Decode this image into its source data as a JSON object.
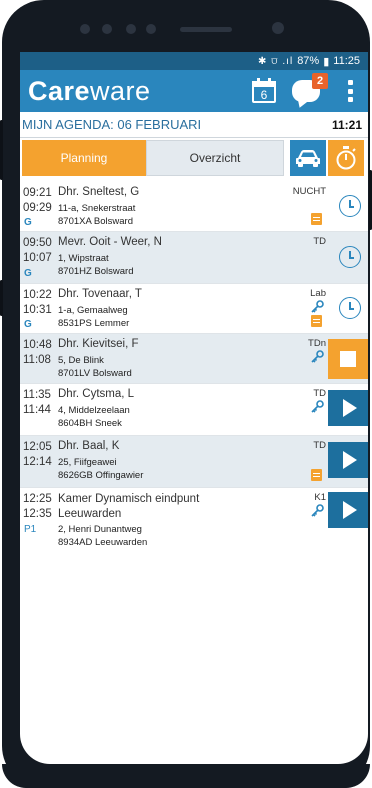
{
  "status_bar": {
    "icons": "✱ ⩌ .ıl",
    "battery_text": "87%",
    "time": "11:25"
  },
  "app_bar": {
    "logo_bold": "Care",
    "logo_light": "ware",
    "calendar_day": "6",
    "messages_badge": "2"
  },
  "agenda": {
    "title": "MIJN AGENDA: 06 FEBRUARI",
    "current_time": "11:21"
  },
  "tabs": {
    "planning": "Planning",
    "overzicht": "Overzicht"
  },
  "colors": {
    "primary": "#2a86bd",
    "dark_primary": "#1d5f87",
    "accent_orange": "#f4a22f",
    "row_alt": "#e4ebf0",
    "badge": "#e8632b"
  },
  "appointments": [
    {
      "start": "09:21",
      "end": "09:29",
      "name": "Dhr. Sneltest, G",
      "street": "11-a, Snekerstraat",
      "postal": "8701XA Bolsward",
      "letter": "G",
      "code": "NUCHT",
      "icons": [
        "note-icon"
      ],
      "action": "clock-icon"
    },
    {
      "start": "09:50",
      "end": "10:07",
      "name": "Mevr. Ooit - Weer, N",
      "street": "1, Wipstraat",
      "postal": "8701HZ Bolsward",
      "letter": "G",
      "code": "TD",
      "icons": [],
      "action": "clock-icon"
    },
    {
      "start": "10:22",
      "end": "10:31",
      "name": "Dhr. Tovenaar, T",
      "street": "1-a, Gemaalweg",
      "postal": "8531PS Lemmer",
      "letter": "G",
      "code": "Lab",
      "icons": [
        "key-icon",
        "note-icon"
      ],
      "action": "clock-icon"
    },
    {
      "start": "10:48",
      "end": "11:08",
      "name": "Dhr. Kievitsei, F",
      "street": "5, De Blink",
      "postal": "8701LV Bolsward",
      "letter": "",
      "code": "TDn",
      "icons": [
        "key-icon"
      ],
      "action": "stop-icon"
    },
    {
      "start": "11:35",
      "end": "11:44",
      "name": "Dhr. Cytsma, L",
      "street": "4, Middelzeelaan",
      "postal": "8604BH Sneek",
      "letter": "",
      "code": "TD",
      "icons": [
        "key-icon"
      ],
      "action": "play-icon"
    },
    {
      "start": "12:05",
      "end": "12:14",
      "name": "Dhr. Baal, K",
      "street": "25, Fiifgeawei",
      "postal": "8626GB Offingawier",
      "letter": "",
      "code": "TD",
      "icons": [
        "note-icon"
      ],
      "action": "play-icon"
    },
    {
      "start": "12:25",
      "end": "12:35",
      "name": "Kamer Dynamisch eindpunt",
      "name2": "Leeuwarden",
      "street": "2, Henri Dunantweg",
      "postal": "8934AD Leeuwarden",
      "letter": "P1",
      "code": "K1",
      "icons": [
        "key-icon"
      ],
      "action": "play-icon"
    }
  ]
}
